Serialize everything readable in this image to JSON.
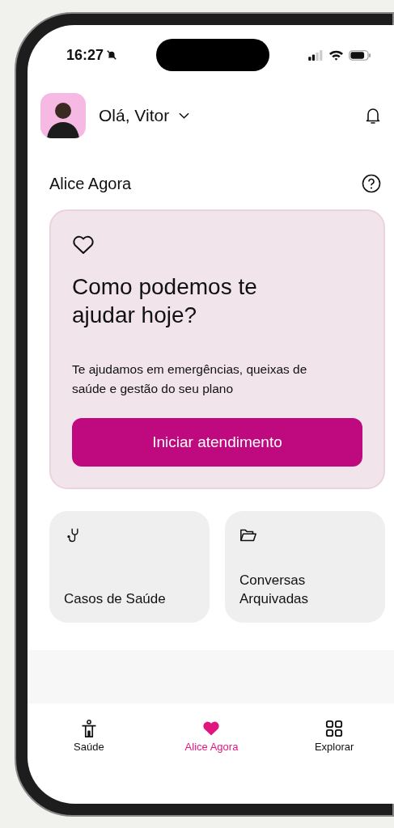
{
  "status_bar": {
    "time": "16:27"
  },
  "header": {
    "greeting": "Olá, Vitor"
  },
  "section": {
    "title": "Alice Agora"
  },
  "hero_card": {
    "heading": "Como podemos te ajudar hoje?",
    "description": "Te ajudamos em emergências, queixas de saúde e gestão do seu plano",
    "button": "Iniciar atendimento"
  },
  "shortcuts": [
    {
      "kind": "stethoscope",
      "label": "Casos de Saúde"
    },
    {
      "kind": "folder",
      "label": "Conversas Arquivadas"
    }
  ],
  "tab_bar": [
    {
      "kind": "body",
      "label": "Saúde",
      "selected": false
    },
    {
      "kind": "heart",
      "label": "Alice Agora",
      "selected": true
    },
    {
      "kind": "grid",
      "label": "Explorar",
      "selected": false
    }
  ]
}
